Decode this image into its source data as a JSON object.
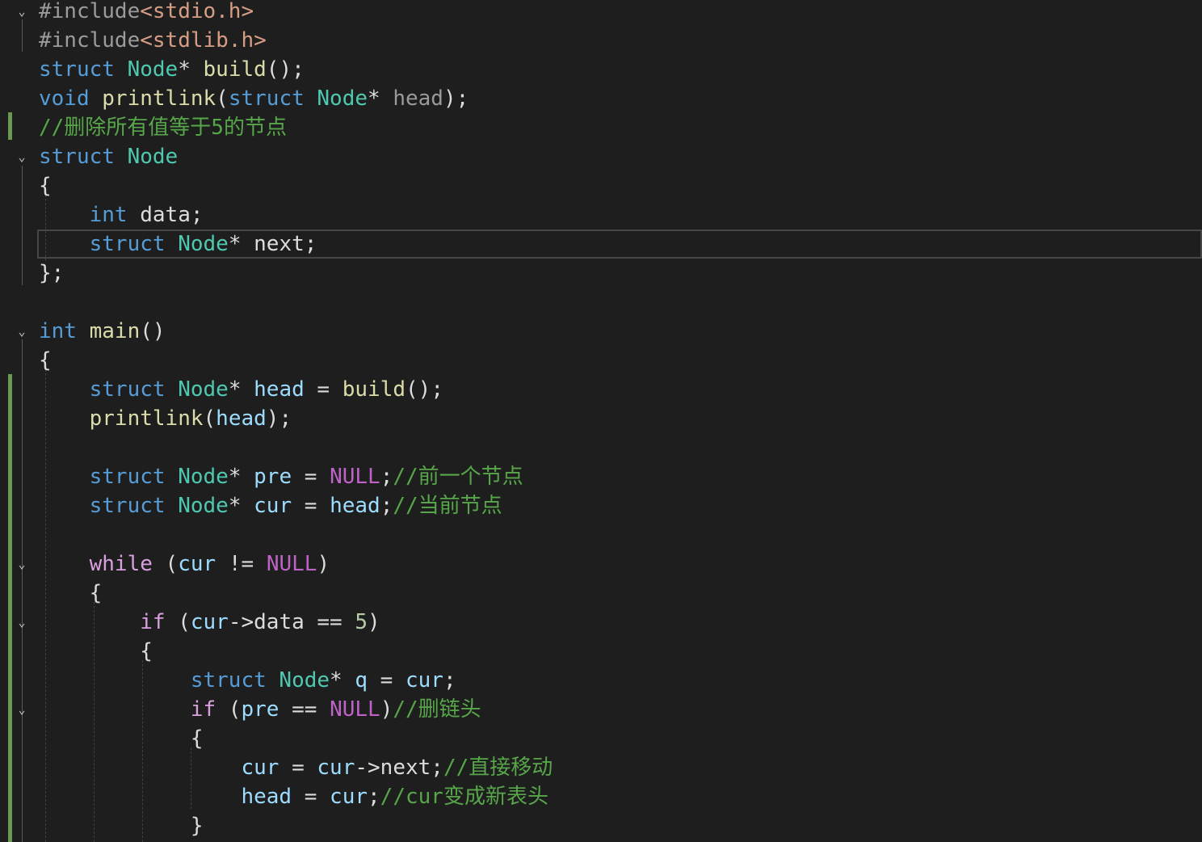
{
  "editor": {
    "colors": {
      "background": "#1e1e1e",
      "keyword": "#569cd6",
      "type": "#4ec9b0",
      "function": "#dcdcaa",
      "comment": "#57a64a",
      "change_bar": "#6a9955"
    },
    "lines": [
      [
        {
          "t": "#include",
          "c": "pp"
        },
        {
          "t": "<stdio.h>",
          "c": "str"
        }
      ],
      [
        {
          "t": "#include",
          "c": "pp"
        },
        {
          "t": "<stdlib.h>",
          "c": "str"
        }
      ],
      [
        {
          "t": "struct ",
          "c": "kw"
        },
        {
          "t": "Node",
          "c": "type"
        },
        {
          "t": "* ",
          "c": "pl"
        },
        {
          "t": "build",
          "c": "fn"
        },
        {
          "t": "();",
          "c": "pl"
        }
      ],
      [
        {
          "t": "void ",
          "c": "kw"
        },
        {
          "t": "printlink",
          "c": "fn"
        },
        {
          "t": "(",
          "c": "pl"
        },
        {
          "t": "struct ",
          "c": "kw"
        },
        {
          "t": "Node",
          "c": "type"
        },
        {
          "t": "* ",
          "c": "pl"
        },
        {
          "t": "head",
          "c": "param"
        },
        {
          "t": ");",
          "c": "pl"
        }
      ],
      [
        {
          "t": "//删除所有值等于5的节点",
          "c": "cmt"
        }
      ],
      [
        {
          "t": "struct ",
          "c": "kw"
        },
        {
          "t": "Node",
          "c": "type"
        }
      ],
      [
        {
          "t": "{",
          "c": "pl"
        }
      ],
      [
        {
          "t": "    ",
          "c": "pl"
        },
        {
          "t": "int ",
          "c": "kw"
        },
        {
          "t": "data;",
          "c": "pl"
        }
      ],
      [
        {
          "t": "    ",
          "c": "pl"
        },
        {
          "t": "struct ",
          "c": "kw"
        },
        {
          "t": "Node",
          "c": "type"
        },
        {
          "t": "* ",
          "c": "pl"
        },
        {
          "t": "next;",
          "c": "pl"
        }
      ],
      [
        {
          "t": "};",
          "c": "pl"
        }
      ],
      [],
      [
        {
          "t": "int ",
          "c": "kw"
        },
        {
          "t": "main",
          "c": "fn"
        },
        {
          "t": "()",
          "c": "pl"
        }
      ],
      [
        {
          "t": "{",
          "c": "pl"
        }
      ],
      [
        {
          "t": "    ",
          "c": "pl"
        },
        {
          "t": "struct ",
          "c": "kw"
        },
        {
          "t": "Node",
          "c": "type"
        },
        {
          "t": "* ",
          "c": "pl"
        },
        {
          "t": "head",
          "c": "var"
        },
        {
          "t": " = ",
          "c": "pl"
        },
        {
          "t": "build",
          "c": "fn"
        },
        {
          "t": "();",
          "c": "pl"
        }
      ],
      [
        {
          "t": "    ",
          "c": "pl"
        },
        {
          "t": "printlink",
          "c": "fn"
        },
        {
          "t": "(",
          "c": "pl"
        },
        {
          "t": "head",
          "c": "var"
        },
        {
          "t": ");",
          "c": "pl"
        }
      ],
      [],
      [
        {
          "t": "    ",
          "c": "pl"
        },
        {
          "t": "struct ",
          "c": "kw"
        },
        {
          "t": "Node",
          "c": "type"
        },
        {
          "t": "* ",
          "c": "pl"
        },
        {
          "t": "pre",
          "c": "var"
        },
        {
          "t": " = ",
          "c": "pl"
        },
        {
          "t": "NULL",
          "c": "macro"
        },
        {
          "t": ";",
          "c": "pl"
        },
        {
          "t": "//前一个节点",
          "c": "cmt"
        }
      ],
      [
        {
          "t": "    ",
          "c": "pl"
        },
        {
          "t": "struct ",
          "c": "kw"
        },
        {
          "t": "Node",
          "c": "type"
        },
        {
          "t": "* ",
          "c": "pl"
        },
        {
          "t": "cur",
          "c": "var"
        },
        {
          "t": " = ",
          "c": "pl"
        },
        {
          "t": "head",
          "c": "var"
        },
        {
          "t": ";",
          "c": "pl"
        },
        {
          "t": "//当前节点",
          "c": "cmt"
        }
      ],
      [],
      [
        {
          "t": "    ",
          "c": "pl"
        },
        {
          "t": "while",
          "c": "ctl"
        },
        {
          "t": " (",
          "c": "pl"
        },
        {
          "t": "cur",
          "c": "var"
        },
        {
          "t": " != ",
          "c": "pl"
        },
        {
          "t": "NULL",
          "c": "macro"
        },
        {
          "t": ")",
          "c": "pl"
        }
      ],
      [
        {
          "t": "    {",
          "c": "pl"
        }
      ],
      [
        {
          "t": "        ",
          "c": "pl"
        },
        {
          "t": "if",
          "c": "ctl"
        },
        {
          "t": " (",
          "c": "pl"
        },
        {
          "t": "cur",
          "c": "var"
        },
        {
          "t": "->data == ",
          "c": "pl"
        },
        {
          "t": "5",
          "c": "num"
        },
        {
          "t": ")",
          "c": "pl"
        }
      ],
      [
        {
          "t": "        {",
          "c": "pl"
        }
      ],
      [
        {
          "t": "            ",
          "c": "pl"
        },
        {
          "t": "struct ",
          "c": "kw"
        },
        {
          "t": "Node",
          "c": "type"
        },
        {
          "t": "* ",
          "c": "pl"
        },
        {
          "t": "q",
          "c": "var"
        },
        {
          "t": " = ",
          "c": "pl"
        },
        {
          "t": "cur",
          "c": "var"
        },
        {
          "t": ";",
          "c": "pl"
        }
      ],
      [
        {
          "t": "            ",
          "c": "pl"
        },
        {
          "t": "if",
          "c": "ctl"
        },
        {
          "t": " (",
          "c": "pl"
        },
        {
          "t": "pre",
          "c": "var"
        },
        {
          "t": " == ",
          "c": "pl"
        },
        {
          "t": "NULL",
          "c": "macro"
        },
        {
          "t": ")",
          "c": "pl"
        },
        {
          "t": "//删链头",
          "c": "cmt"
        }
      ],
      [
        {
          "t": "            {",
          "c": "pl"
        }
      ],
      [
        {
          "t": "                ",
          "c": "pl"
        },
        {
          "t": "cur",
          "c": "var"
        },
        {
          "t": " = ",
          "c": "pl"
        },
        {
          "t": "cur",
          "c": "var"
        },
        {
          "t": "->next;",
          "c": "pl"
        },
        {
          "t": "//直接移动",
          "c": "cmt"
        }
      ],
      [
        {
          "t": "                ",
          "c": "pl"
        },
        {
          "t": "head",
          "c": "var"
        },
        {
          "t": " = ",
          "c": "pl"
        },
        {
          "t": "cur",
          "c": "var"
        },
        {
          "t": ";",
          "c": "pl"
        },
        {
          "t": "//cur变成新表头",
          "c": "cmt"
        }
      ],
      [
        {
          "t": "            }",
          "c": "pl"
        }
      ]
    ],
    "current_line": 8,
    "fold_icon": "chevron-down-icon",
    "fold_glyph": "⌄",
    "fold_lines": [
      0,
      5,
      11,
      19,
      21,
      24
    ]
  }
}
